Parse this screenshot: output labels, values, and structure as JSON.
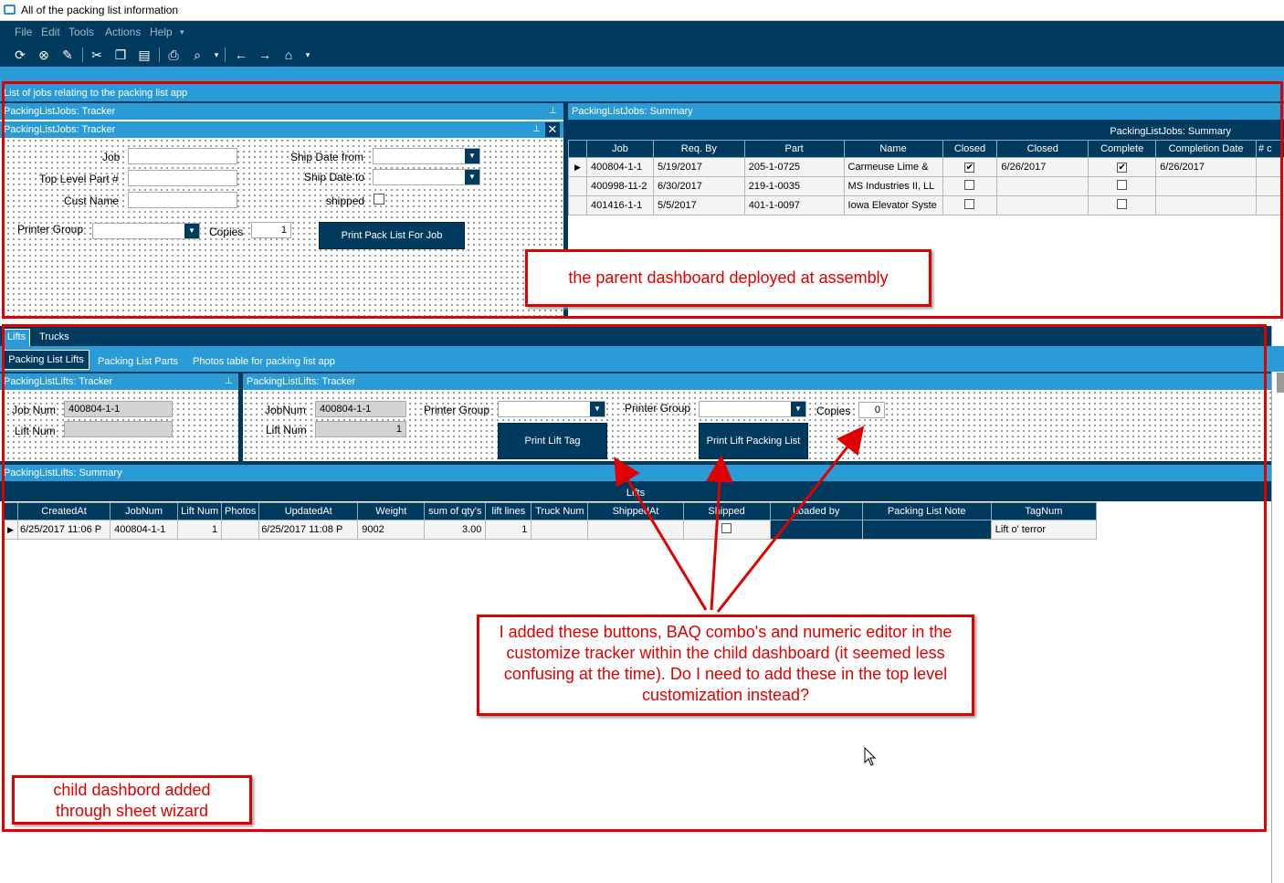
{
  "window": {
    "title": "All of the packing list information"
  },
  "menu": [
    "File",
    "Edit",
    "Tools",
    "Actions",
    "Help"
  ],
  "toolbar_icons": [
    "refresh-icon",
    "clear-icon",
    "broom-icon",
    "cut-icon",
    "copy-icon",
    "paste-icon",
    "print-icon",
    "print-preview-icon",
    "back-icon",
    "forward-icon",
    "home-icon"
  ],
  "top_section": {
    "caption": "List of jobs relating to the packing list app",
    "tracker_outer": "PackingListJobs: Tracker",
    "tracker_inner": "PackingListJobs: Tracker",
    "summary_header": "PackingListJobs: Summary",
    "summary_title": "PackingListJobs: Summary",
    "fields": {
      "job": "Job",
      "top_level_part": "Top Level Part #",
      "cust_name": "Cust Name",
      "ship_date_from": "Ship Date from",
      "ship_date_to": "Ship Date to",
      "shipped": "shipped",
      "printer_group": "Printer Group",
      "copies": "Copies",
      "copies_value": "1"
    },
    "print_button": "Print Pack List For Job",
    "grid": {
      "columns": [
        "Job",
        "Req. By",
        "Part",
        "Name",
        "Closed",
        "Closed",
        "Complete",
        "Completion Date",
        "# c"
      ],
      "rows": [
        {
          "job": "400804-1-1",
          "req_by": "5/19/2017",
          "part": "205-1-0725",
          "name": "Carmeuse Lime &",
          "closed_chk": true,
          "closed_date": "6/26/2017",
          "complete": true,
          "completion_date": "6/26/2017"
        },
        {
          "job": "400998-11-2",
          "req_by": "6/30/2017",
          "part": "219-1-0035",
          "name": "MS Industries II, LL",
          "closed_chk": false,
          "closed_date": "",
          "complete": false,
          "completion_date": ""
        },
        {
          "job": "401416-1-1",
          "req_by": "5/5/2017",
          "part": "401-1-0097",
          "name": "Iowa Elevator Syste",
          "closed_chk": false,
          "closed_date": "",
          "complete": false,
          "completion_date": ""
        }
      ]
    }
  },
  "bottom_section": {
    "tabs": [
      "Lifts",
      "Trucks"
    ],
    "subtabs": [
      "Packing List Lifts",
      "Packing List Parts",
      "Photos table for packing list app"
    ],
    "tracker_left": "PackingListLifts: Tracker",
    "tracker_right": "PackingListLifts: Tracker",
    "summary_header": "PackingListLifts: Summary",
    "summary_title": "Lifts",
    "left": {
      "job_num": "Job Num",
      "job_num_value": "400804-1-1",
      "lift_num": "Lift Num"
    },
    "right": {
      "job_num": "JobNum",
      "job_num_value": "400804-1-1",
      "lift_num": "Lift Num",
      "lift_num_value": "1",
      "printer_group_1": "Printer Group",
      "printer_group_2": "Printer Group",
      "copies": "Copies",
      "copies_value": "0",
      "print_lift_tag": "Print Lift Tag",
      "print_lift_packing_list": "Print Lift Packing List"
    },
    "grid": {
      "columns": [
        "CreatedAt",
        "JobNum",
        "Lift Num",
        "Photos",
        "UpdatedAt",
        "Weight",
        "sum of qty's",
        "lift lines",
        "Truck Num",
        "ShippedAt",
        "Shipped",
        "Loaded by",
        "Packing List Note",
        "TagNum"
      ],
      "row": {
        "created_at": "6/25/2017 11:06 P",
        "job_num": "400804-1-1",
        "lift_num": "1",
        "photos": "",
        "updated_at": "6/25/2017 11:08 P",
        "weight": "9002",
        "sum_qty": "3.00",
        "lift_lines": "1",
        "truck_num": "",
        "shipped_at": "",
        "shipped": false,
        "loaded_by": "",
        "note": "",
        "tag_num": "Lift o' terror"
      }
    }
  },
  "annotations": {
    "parent": "the parent dashboard deployed at assembly",
    "question": "I added these buttons, BAQ combo's and numeric editor in the customize tracker within the child dashboard (it seemed less confusing at the time). Do I need to add these in the top level customization instead?",
    "child": "child dashbord added through sheet wizard"
  },
  "colors": {
    "navy": "#003a5f",
    "blue": "#2a9bd6",
    "annotation_red": "#e00000"
  }
}
